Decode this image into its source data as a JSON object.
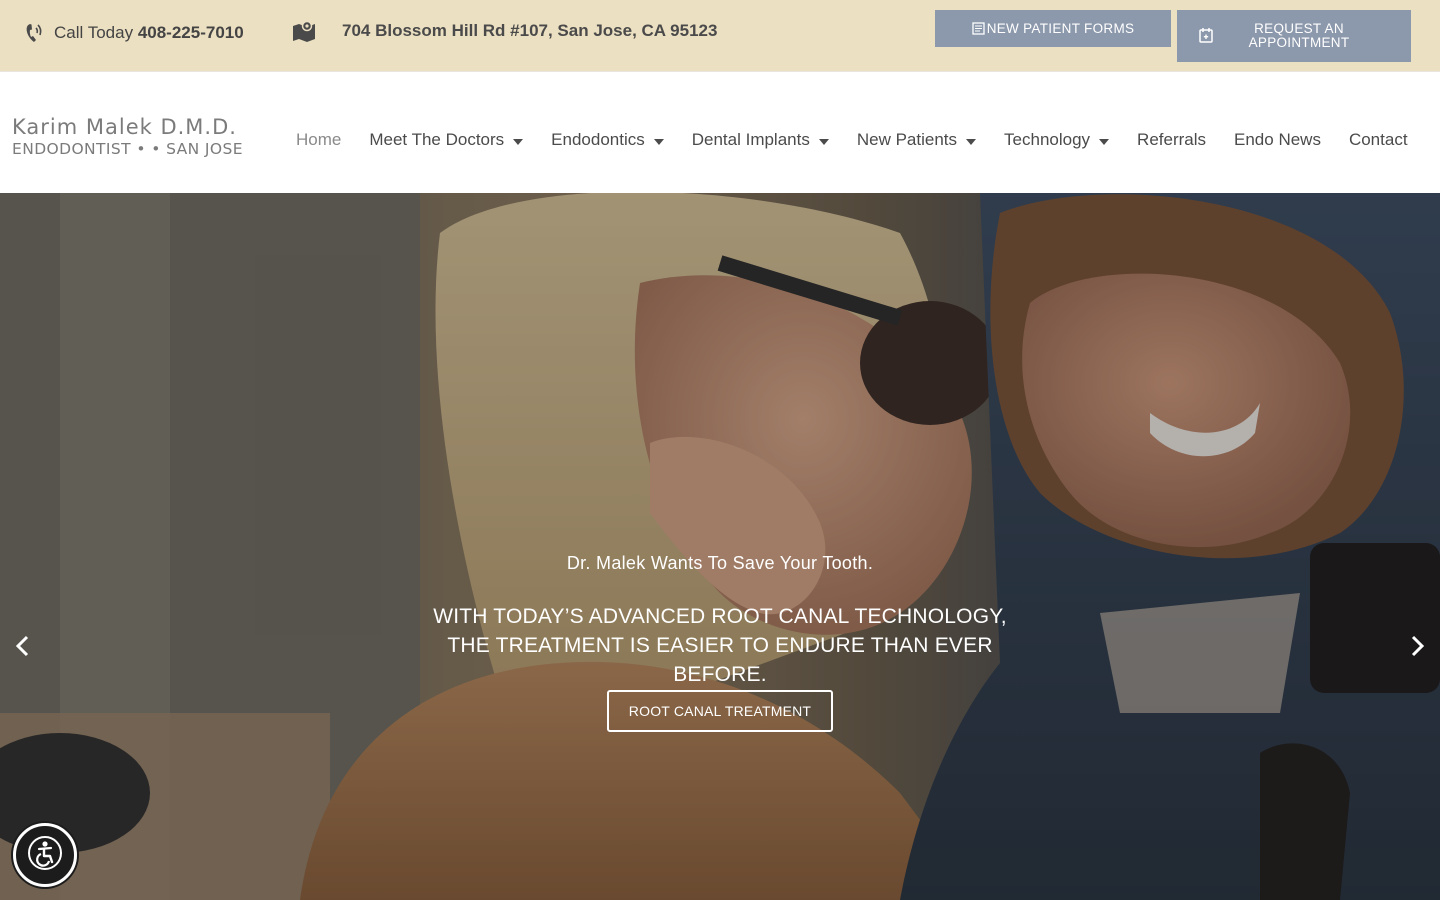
{
  "topbar": {
    "phone_prefix": "Call Today",
    "phone_number": "408-225-7010",
    "address": "704 Blossom Hill Rd #107, San Jose, CA 95123",
    "forms_button": "NEW PATIENT FORMS",
    "appointment_button": "REQUEST AN APPOINTMENT",
    "background_color": "#ece0c2",
    "button_color": "#8c98ab"
  },
  "logo": {
    "line1": "Karim Malek D.M.D.",
    "line2": "ENDODONTIST • • SAN JOSE"
  },
  "nav": {
    "items": [
      {
        "label": "Home",
        "active": true,
        "dropdown": false
      },
      {
        "label": "Meet The Doctors",
        "dropdown": true
      },
      {
        "label": "Endodontics",
        "dropdown": true
      },
      {
        "label": "Dental Implants",
        "dropdown": true
      },
      {
        "label": "New Patients",
        "dropdown": true
      },
      {
        "label": "Technology",
        "dropdown": true
      },
      {
        "label": "Referrals",
        "dropdown": false
      },
      {
        "label": "Endo News",
        "dropdown": false
      },
      {
        "label": "Contact",
        "dropdown": false
      }
    ]
  },
  "hero": {
    "subtitle": "Dr. Malek Wants To Save Your Tooth.",
    "title": "WITH TODAY’S ADVANCED ROOT CANAL TECHNOLOGY, THE TREATMENT IS EASIER TO ENDURE THAN EVER BEFORE.",
    "cta": "ROOT CANAL TREATMENT",
    "image_description_icon": "smiling-couple-photo"
  },
  "icons": {
    "phone": "phone-icon",
    "map": "map-icon",
    "forms": "form-icon",
    "calendar": "calendar-icon",
    "prev": "chevron-left-icon",
    "next": "chevron-right-icon",
    "accessibility": "accessibility-icon"
  }
}
